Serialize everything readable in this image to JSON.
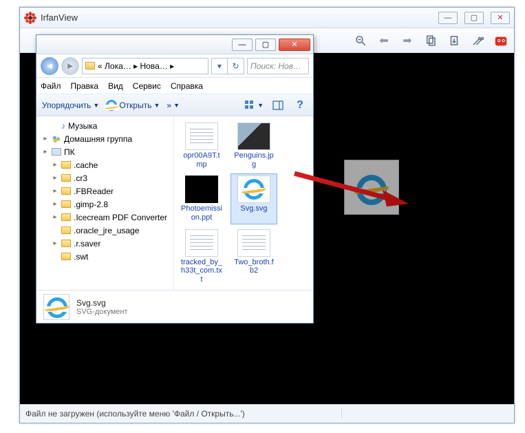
{
  "irfanview": {
    "title": "IrfanView",
    "status": "Файл не загружен (используйте меню 'Файл / Открыть...')"
  },
  "explorer": {
    "address": {
      "sep": "«",
      "parts": [
        "Лока…",
        "Нова…"
      ],
      "chev": "▸"
    },
    "search_placeholder": "Поиск: Нов…",
    "menu": {
      "file": "Файл",
      "edit": "Правка",
      "view": "Вид",
      "service": "Сервис",
      "help": "Справка"
    },
    "cmdbar": {
      "organize": "Упорядочить",
      "open": "Открыть",
      "more": "»"
    },
    "tree": [
      {
        "label": "Музыка",
        "icon": "music",
        "indent": 1
      },
      {
        "label": "Домашняя группа",
        "icon": "group",
        "indent": 0,
        "tog": "▸"
      },
      {
        "label": "ПК",
        "icon": "pc",
        "indent": 0,
        "tog": "▸"
      },
      {
        "label": ".cache",
        "icon": "folder",
        "indent": 1,
        "tog": "▸"
      },
      {
        "label": ".cr3",
        "icon": "folder",
        "indent": 1,
        "tog": "▸"
      },
      {
        "label": ".FBReader",
        "icon": "folder",
        "indent": 1,
        "tog": "▸"
      },
      {
        "label": ".gimp-2.8",
        "icon": "folder",
        "indent": 1,
        "tog": "▸"
      },
      {
        "label": ".Icecream PDF Converter",
        "icon": "folder",
        "indent": 1,
        "tog": "▸"
      },
      {
        "label": ".oracle_jre_usage",
        "icon": "folder",
        "indent": 1
      },
      {
        "label": ".r.saver",
        "icon": "folder",
        "indent": 1,
        "tog": "▸"
      },
      {
        "label": ".swt",
        "icon": "folder",
        "indent": 1
      }
    ],
    "files": {
      "tmp": "opr00A9T.tmp",
      "penguins": "Penguins.jpg",
      "ppt": "Photoemission.ppt",
      "svg": "Svg.svg",
      "txt": "tracked_by_h33t_com.txt",
      "fb2": "Two_broth.fb2"
    },
    "details": {
      "name": "Svg.svg",
      "type": "SVG-документ"
    }
  }
}
